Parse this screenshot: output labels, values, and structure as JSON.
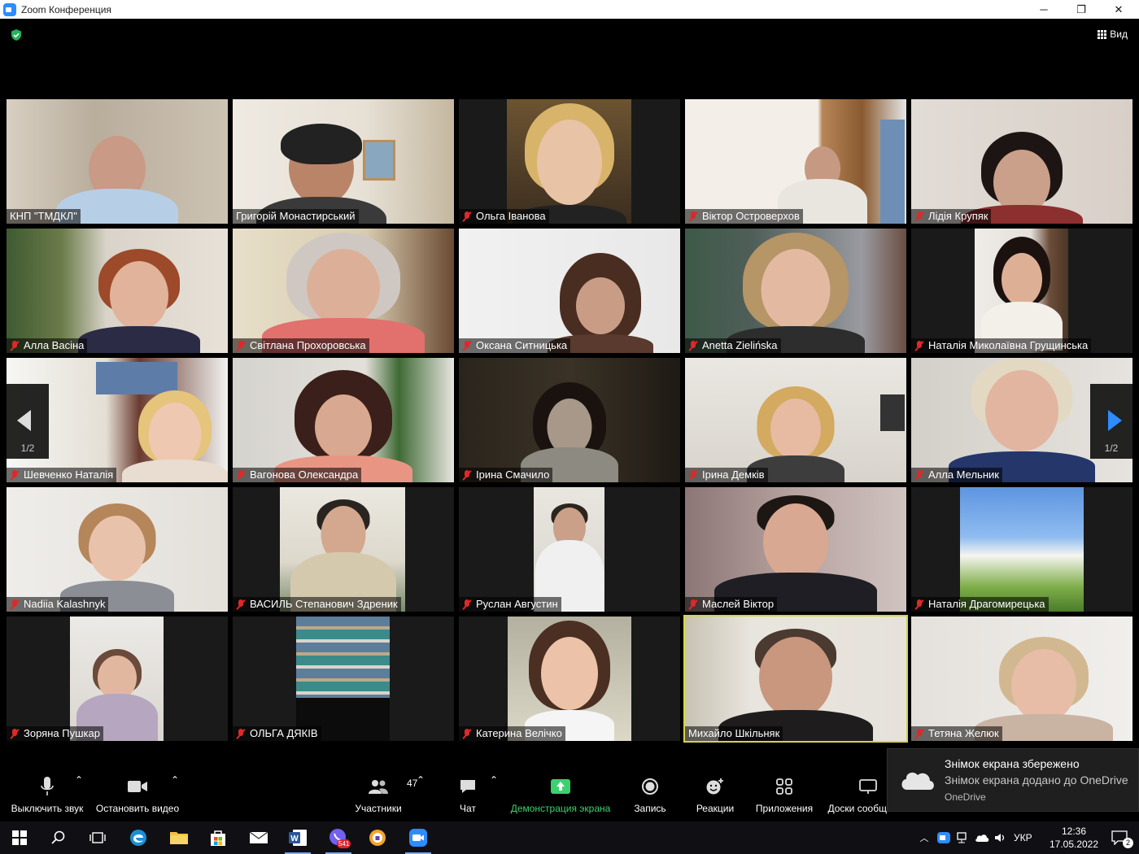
{
  "window": {
    "title": "Zoom Конференция",
    "minimize": "─",
    "maximize": "❐",
    "close": "✕"
  },
  "topbar": {
    "view_label": "Вид"
  },
  "participants": [
    {
      "name": "КНП \"ТМДКЛ\"",
      "muted": false
    },
    {
      "name": "Григорій Монастирський",
      "muted": false
    },
    {
      "name": "Ольга Іванова",
      "muted": true
    },
    {
      "name": "Віктор Островерхов",
      "muted": true
    },
    {
      "name": "Лідія Крупяк",
      "muted": true
    },
    {
      "name": "Алла Васіна",
      "muted": true
    },
    {
      "name": "Світлана Прохоровська",
      "muted": true
    },
    {
      "name": "Оксана Ситницька",
      "muted": true
    },
    {
      "name": "Anetta Zielińska",
      "muted": true
    },
    {
      "name": "Наталія Миколаївна Грущинська",
      "muted": true
    },
    {
      "name": "Шевченко Наталія",
      "muted": true
    },
    {
      "name": "Вагонова Олександра",
      "muted": true
    },
    {
      "name": "Ірина Смачило",
      "muted": true
    },
    {
      "name": "Ірина Демків",
      "muted": true
    },
    {
      "name": "Алла Мельник",
      "muted": true
    },
    {
      "name": "Nadiia Kalashnyk",
      "muted": true
    },
    {
      "name": "ВАСИЛЬ Степанович Здреник",
      "muted": true
    },
    {
      "name": "Руслан Августин",
      "muted": true
    },
    {
      "name": "Маслей Віктор",
      "muted": true
    },
    {
      "name": "Наталія Драгомирецька",
      "muted": true
    },
    {
      "name": "Зоряна Пушкар",
      "muted": true
    },
    {
      "name": "ОЛЬГА ДЯКІВ",
      "muted": true
    },
    {
      "name": "Катерина Велічко",
      "muted": true
    },
    {
      "name": "Михайло Шкільняк",
      "muted": false,
      "speaking": true
    },
    {
      "name": "Тетяна Желюк",
      "muted": true
    }
  ],
  "pagination": {
    "left": "1/2",
    "right": "1/2"
  },
  "toolbar": {
    "mute_label": "Выключить звук",
    "video_label": "Остановить видео",
    "participants_label": "Участники",
    "participants_count": "47",
    "chat_label": "Чат",
    "share_label": "Демонстрация экрана",
    "record_label": "Запись",
    "reactions_label": "Реакции",
    "apps_label": "Приложения",
    "whiteboard_label": "Доски сообщений"
  },
  "notification": {
    "title": "Знімок екрана збережено",
    "body": "Знімок екрана додано до OneDrive",
    "source": "OneDrive"
  },
  "taskbar": {
    "viber_badge": "541",
    "language": "УКР",
    "time": "12:36",
    "date": "17.05.2022",
    "notif_count": "2"
  },
  "colors": {
    "accent": "#2d8cff",
    "muted_red": "#e02828",
    "share_green": "#3bd16f",
    "speaker_outline": "#d4d44a"
  }
}
